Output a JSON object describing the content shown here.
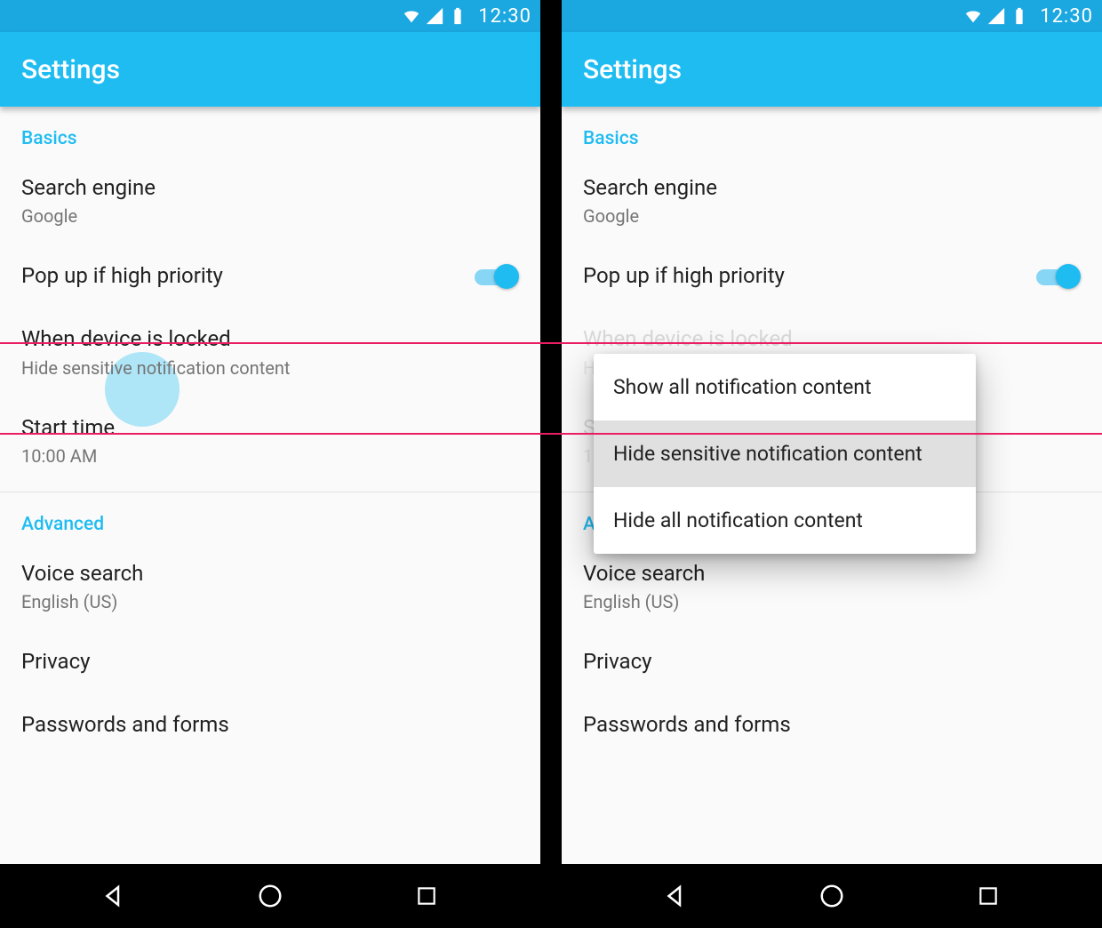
{
  "status": {
    "time": "12:30"
  },
  "appbar": {
    "title": "Settings"
  },
  "sections": {
    "basics": {
      "header": "Basics",
      "search_engine": {
        "label": "Search engine",
        "value": "Google"
      },
      "popup": {
        "label": "Pop up if high priority"
      },
      "locked": {
        "label": "When device is locked",
        "value": "Hide sensitive notification content"
      },
      "start_time": {
        "label": "Start time",
        "value": "10:00 AM"
      }
    },
    "advanced": {
      "header": "Advanced",
      "voice_search": {
        "label": "Voice search",
        "value": "English (US)"
      },
      "privacy": {
        "label": "Privacy"
      },
      "passwords": {
        "label": "Passwords and forms"
      }
    }
  },
  "dialog": {
    "options": [
      {
        "label": "Show all notification content"
      },
      {
        "label": "Hide sensitive notification content"
      },
      {
        "label": "Hide all notification content"
      }
    ]
  }
}
